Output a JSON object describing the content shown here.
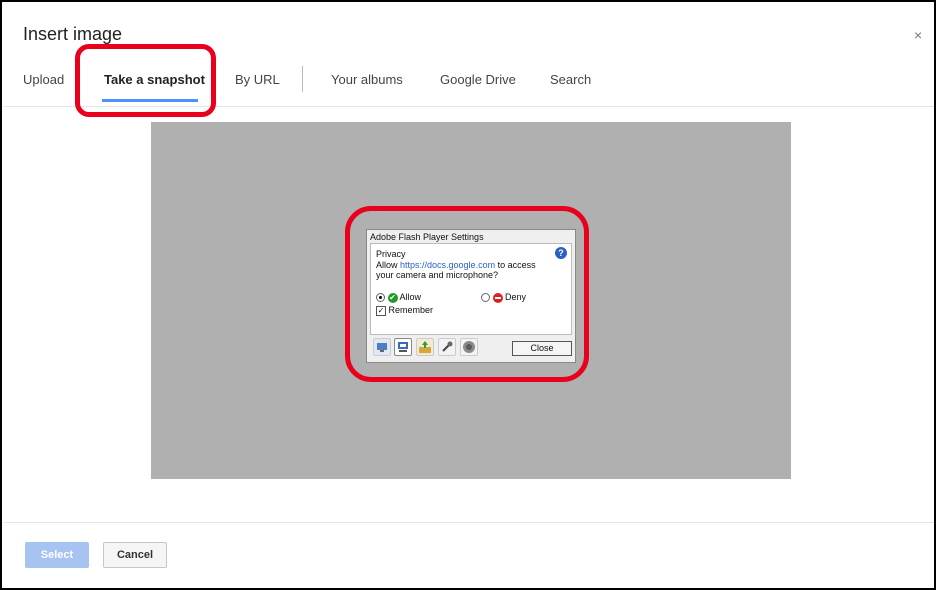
{
  "dialog": {
    "title": "Insert image",
    "close_glyph": "×"
  },
  "tabs": [
    {
      "label": "Upload",
      "active": false
    },
    {
      "label": "Take a snapshot",
      "active": true
    },
    {
      "label": "By URL",
      "active": false
    },
    {
      "label": "Your albums",
      "active": false
    },
    {
      "label": "Google Drive",
      "active": false
    },
    {
      "label": "Search",
      "active": false
    }
  ],
  "flash": {
    "title": "Adobe Flash Player Settings",
    "section": "Privacy",
    "prompt_prefix": "Allow ",
    "prompt_link": "https://docs.google.com",
    "prompt_suffix": " to access",
    "prompt_line2": "your camera and microphone?",
    "allow_label": "Allow",
    "deny_label": "Deny",
    "remember_label": "Remember",
    "allow_selected": true,
    "remember_checked": true,
    "close_label": "Close",
    "toolbar_icons": [
      "display-icon",
      "privacy-icon",
      "storage-icon",
      "microphone-icon",
      "camera-icon"
    ]
  },
  "footer": {
    "select_label": "Select",
    "cancel_label": "Cancel"
  },
  "colors": {
    "highlight": "#e8001c",
    "tab_underline": "#4d90fe",
    "select_button": "#a7c3f2",
    "snapshot_area": "#b0b0b0"
  }
}
